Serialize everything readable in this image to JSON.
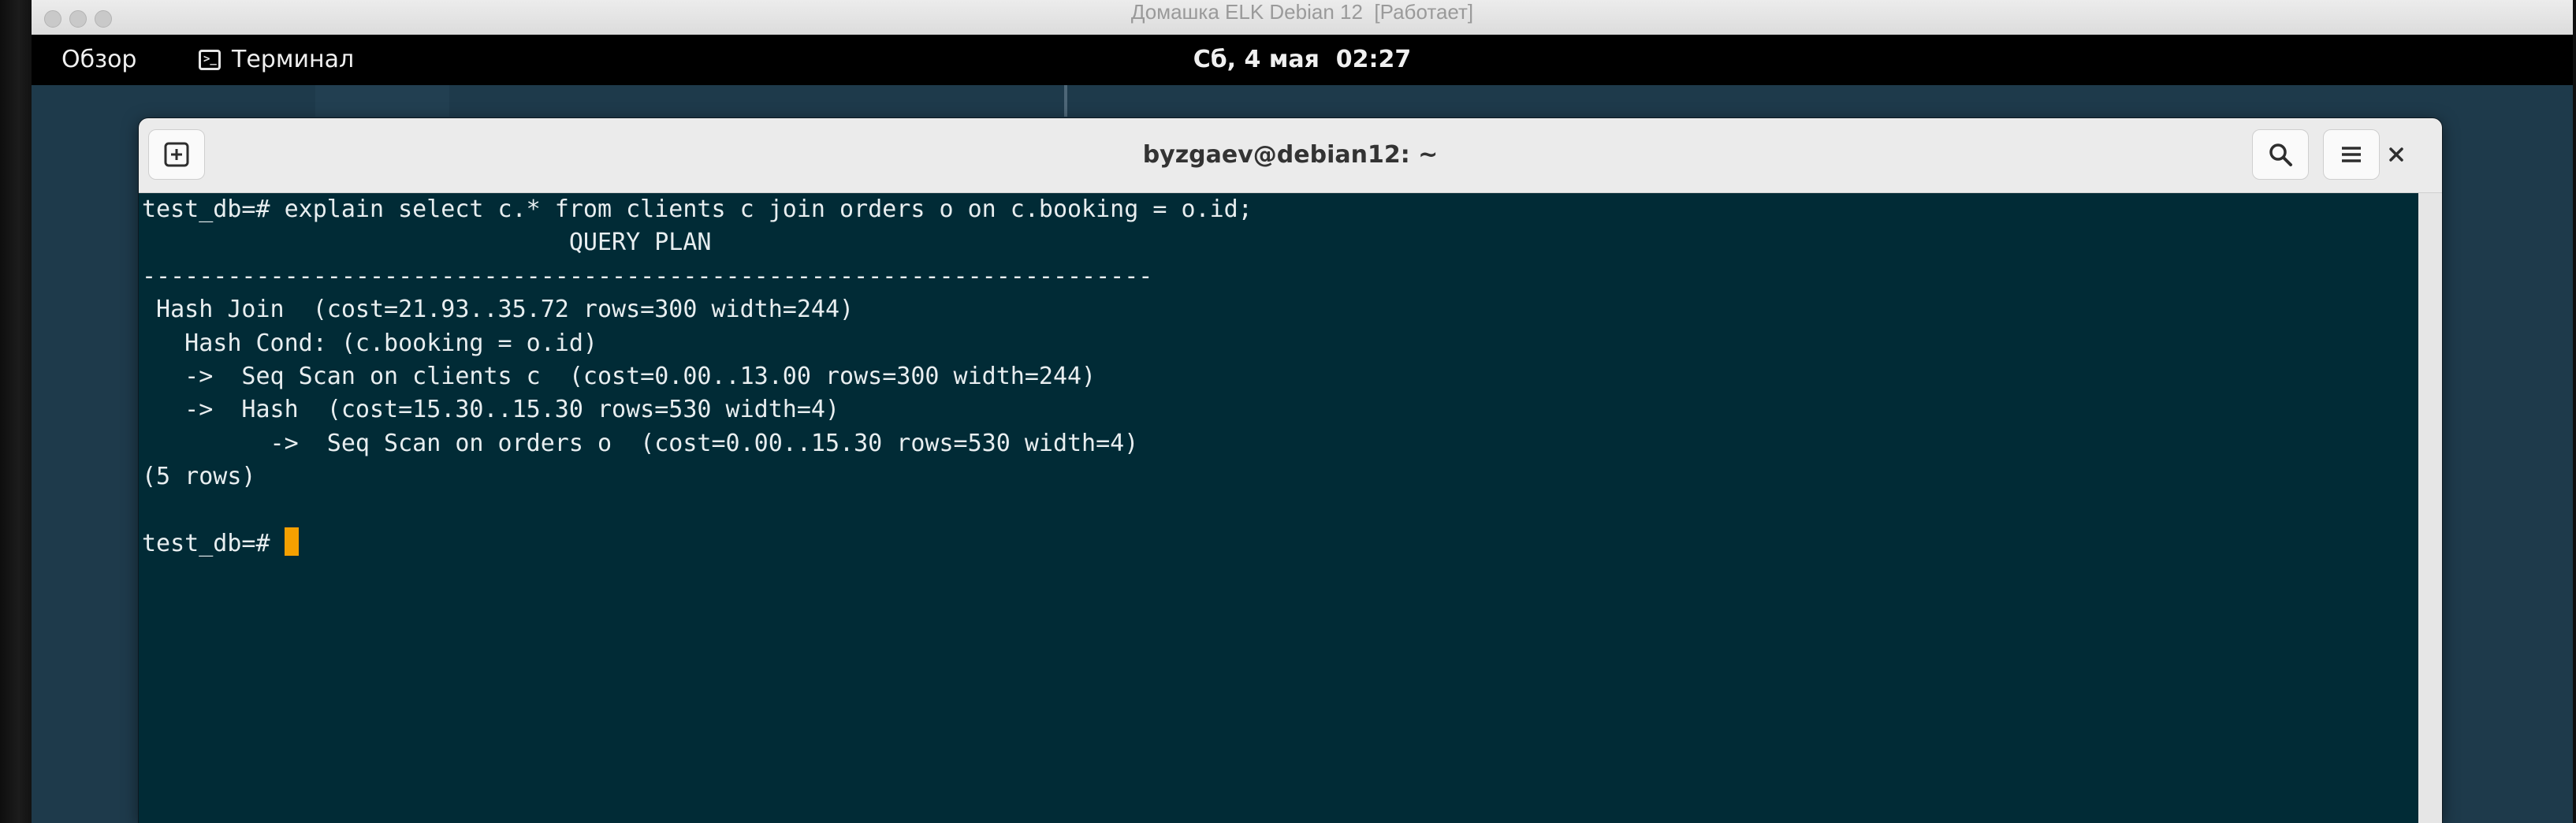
{
  "vm": {
    "title": "Домашка ELK Debian 12  [Работает]"
  },
  "topbar": {
    "activities": "Обзор",
    "app_name": "Терминал",
    "app_icon_glyph": ">_",
    "clock": "Сб, 4 мая  02:27"
  },
  "terminal": {
    "title": "byzgaev@debian12: ~",
    "new_tab_icon": "new-tab-icon",
    "search_icon": "search-icon",
    "menu_icon": "hamburger-menu-icon",
    "close_icon": "close-icon",
    "cursor_color": "#f5a000",
    "background_color": "#012b36",
    "lines": [
      "test_db=# explain select c.* from clients c join orders o on c.booking = o.id;",
      "                              QUERY PLAN",
      "-----------------------------------------------------------------------",
      " Hash Join  (cost=21.93..35.72 rows=300 width=244)",
      "   Hash Cond: (c.booking = o.id)",
      "   ->  Seq Scan on clients c  (cost=0.00..13.00 rows=300 width=244)",
      "   ->  Hash  (cost=15.30..15.30 rows=530 width=4)",
      "         ->  Seq Scan on orders o  (cost=0.00..15.30 rows=530 width=4)",
      "(5 rows)",
      "",
      "test_db=# "
    ]
  }
}
